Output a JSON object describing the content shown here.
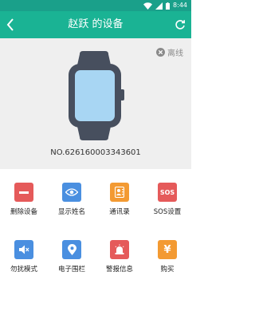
{
  "status_bar": {
    "time": "8:44",
    "icons": [
      "wifi-icon",
      "signal-icon",
      "battery-icon"
    ]
  },
  "header": {
    "title": "赵跃 的设备",
    "back_icon": "chevron-left-icon",
    "refresh_icon": "refresh-icon"
  },
  "device": {
    "status": "离线",
    "number": "NO.626160003343601",
    "image": "smartwatch"
  },
  "functions": [
    {
      "label": "删除设备",
      "icon": "delete-icon",
      "color": "#e55a5a"
    },
    {
      "label": "显示姓名",
      "icon": "eye-icon",
      "color": "#4a8fe0"
    },
    {
      "label": "通讯录",
      "icon": "contacts-icon",
      "color": "#f39a32"
    },
    {
      "label": "SOS设置",
      "icon": "sos-icon",
      "color": "#e55a5a",
      "glyph": "SOS"
    },
    {
      "label": "勿扰模式",
      "icon": "mute-icon",
      "color": "#4a8fe0"
    },
    {
      "label": "电子围栏",
      "icon": "location-icon",
      "color": "#4a8fe0"
    },
    {
      "label": "警报信息",
      "icon": "alarm-icon",
      "color": "#e55a5a"
    },
    {
      "label": "购买",
      "icon": "yuan-icon",
      "color": "#f39a32",
      "glyph": "¥"
    }
  ],
  "colors": {
    "primary": "#1ab394",
    "status_bar": "#1aa08a",
    "device_bg": "#efefef"
  }
}
